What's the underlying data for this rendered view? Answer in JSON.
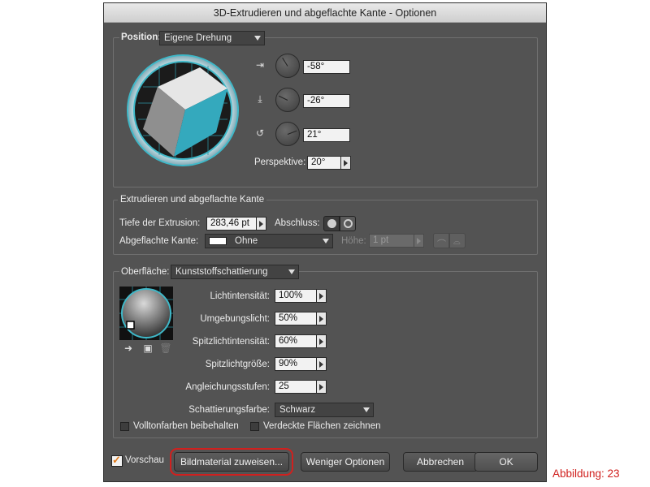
{
  "window": {
    "title": "3D-Extrudieren und abgeflachte Kante - Optionen"
  },
  "position": {
    "label": "Position:",
    "preset": "Eigene Drehung",
    "x_angle": "-58°",
    "y_angle": "-26°",
    "z_angle": "21°",
    "perspective_label": "Perspektive:",
    "perspective_value": "20°"
  },
  "extrude": {
    "heading": "Extrudieren und abgeflachte Kante",
    "depth_label": "Tiefe der Extrusion:",
    "depth_value": "283,46 pt",
    "cap_label": "Abschluss:",
    "bevel_label": "Abgeflachte Kante:",
    "bevel_value": "Ohne",
    "height_label": "Höhe:",
    "height_value": "1 pt"
  },
  "surface": {
    "label": "Oberfläche:",
    "preset": "Kunststoffschattierung",
    "light_intensity_label": "Lichtintensität:",
    "light_intensity_value": "100%",
    "ambient_label": "Umgebungslicht:",
    "ambient_value": "50%",
    "highlight_intensity_label": "Spitzlichtintensität:",
    "highlight_intensity_value": "60%",
    "highlight_size_label": "Spitzlichtgröße:",
    "highlight_size_value": "90%",
    "blend_steps_label": "Angleichungsstufen:",
    "blend_steps_value": "25",
    "shading_color_label": "Schattierungsfarbe:",
    "shading_color_value": "Schwarz",
    "preserve_spot_label": "Volltonfarben beibehalten",
    "draw_hidden_label": "Verdeckte Flächen zeichnen"
  },
  "footer": {
    "preview_label": "Vorschau",
    "preview_checked": true,
    "map_art_label": "Bildmaterial zuweisen...",
    "fewer_options_label": "Weniger Optionen",
    "cancel_label": "Abbrechen",
    "ok_label": "OK"
  },
  "caption": "Abbildung: 23",
  "colors": {
    "accent": "#d0201e",
    "cube_teal": "#34a9bd",
    "ring_teal": "#3fb8c8"
  }
}
